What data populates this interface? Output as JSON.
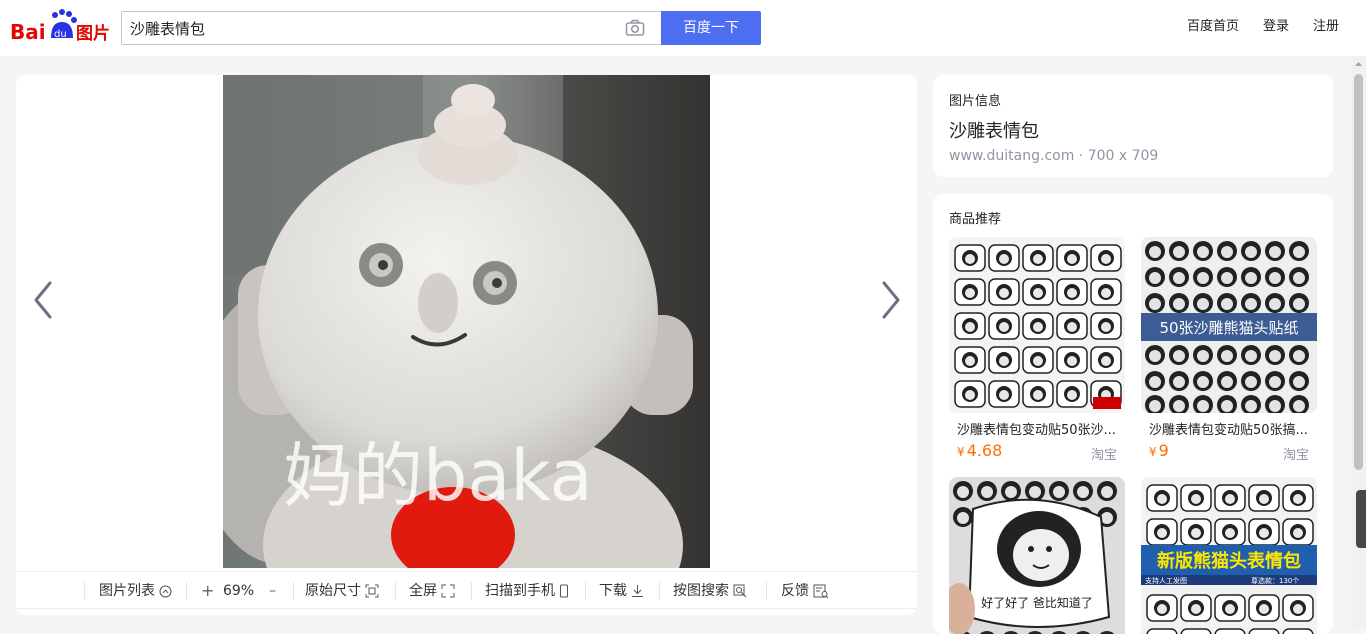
{
  "header": {
    "logo_text": "Bai du 图片",
    "search_value": "沙雕表情包",
    "search_button": "百度一下",
    "nav": [
      "百度首页",
      "登录",
      "注册"
    ]
  },
  "image": {
    "caption": "妈的baka"
  },
  "toolbar": {
    "image_list": "图片列表",
    "zoom_in": "+",
    "zoom_level": "69%",
    "zoom_out": "–",
    "original_size": "原始尺寸",
    "fullscreen": "全屏",
    "scan_to_phone": "扫描到手机",
    "download": "下载",
    "search_by_image": "按图搜索",
    "feedback": "反馈"
  },
  "info": {
    "label": "图片信息",
    "title": "沙雕表情包",
    "source": "www.duitang.com · 700 x 709"
  },
  "shop": {
    "title": "商品推荐",
    "products": [
      {
        "name": "沙雕表情包变动贴50张沙...",
        "price": "4.68",
        "currency": "¥",
        "store": "淘宝",
        "banner": ""
      },
      {
        "name": "沙雕表情包变动贴50张搞...",
        "price": "9",
        "currency": "¥",
        "store": "淘宝",
        "banner": "50张沙雕熊猫头贴纸"
      },
      {
        "name": "",
        "price": "",
        "currency": "",
        "store": "",
        "banner": "好了好了 爸比知道了"
      },
      {
        "name": "",
        "price": "",
        "currency": "",
        "store": "",
        "banner": "新版熊猫头表情包",
        "sub_left": "支持人工发图",
        "sub_right": "尊选款：130个"
      }
    ]
  },
  "colors": {
    "brand_blue": "#4e6ef2",
    "price_orange": "#ff6d00",
    "baidu_red": "#e10601",
    "baidu_blue": "#2932e1"
  }
}
